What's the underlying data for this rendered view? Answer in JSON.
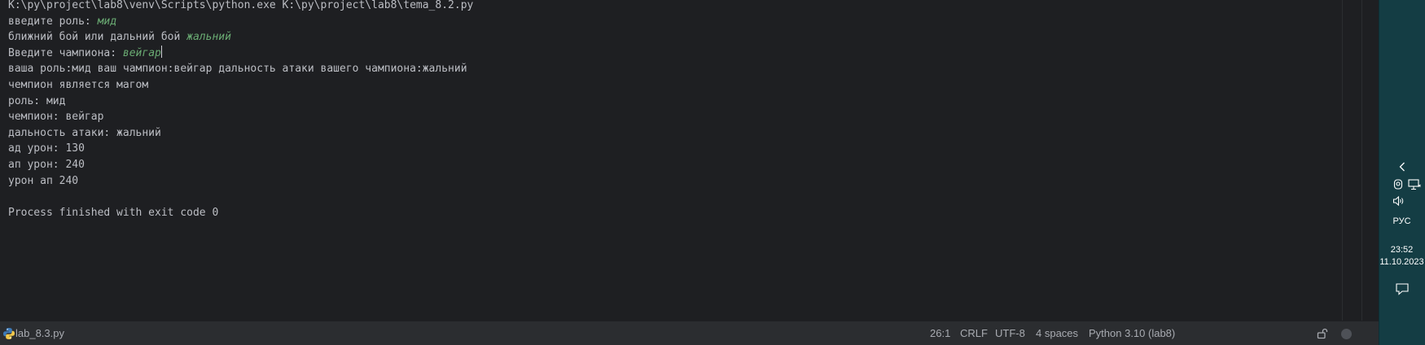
{
  "console": {
    "lines": [
      {
        "text": "K:\\py\\project\\lab8\\venv\\Scripts\\python.exe K:\\py\\project\\lab8\\tema_8.2.py",
        "input": ""
      },
      {
        "text": "введите роль: ",
        "input": "мид"
      },
      {
        "text": "ближний бой или дальний бой ",
        "input": "жальний"
      },
      {
        "text": "Введите чампиона: ",
        "input": "вейгар"
      },
      {
        "text": "ваша роль:мид ваш чампион:вейгар дальность атаки вашего чампиона:жальний",
        "input": ""
      },
      {
        "text": "чемпион является магом",
        "input": ""
      },
      {
        "text": "роль: мид",
        "input": ""
      },
      {
        "text": "чемпион: вейгар",
        "input": ""
      },
      {
        "text": "дальность атаки: жальний",
        "input": ""
      },
      {
        "text": "ад урон: 130",
        "input": ""
      },
      {
        "text": "ап урон: 240",
        "input": ""
      },
      {
        "text": "урон ап 240",
        "input": ""
      },
      {
        "text": "",
        "input": ""
      },
      {
        "text": "Process finished with exit code 0",
        "input": ""
      }
    ],
    "text_color": "#bcbec4",
    "input_color": "#6aab73"
  },
  "statusbar": {
    "file_name": "lab_8.3.py",
    "file_icon": "python-file-icon",
    "cursor_position": "26:1",
    "line_separator": "CRLF",
    "encoding": "UTF-8",
    "indent": "4 spaces",
    "interpreter": "Python 3.10 (lab8)",
    "readonly_icon": "unlock-icon",
    "status_icon": "inspection-circle-icon"
  },
  "taskbar": {
    "language": "РУС",
    "time": "23:52",
    "date": "11.10.2023",
    "icons": [
      "chevron-left-icon",
      "webcam-icon",
      "network-icon",
      "volume-icon",
      "notification-icon"
    ],
    "background": "#143d44"
  }
}
